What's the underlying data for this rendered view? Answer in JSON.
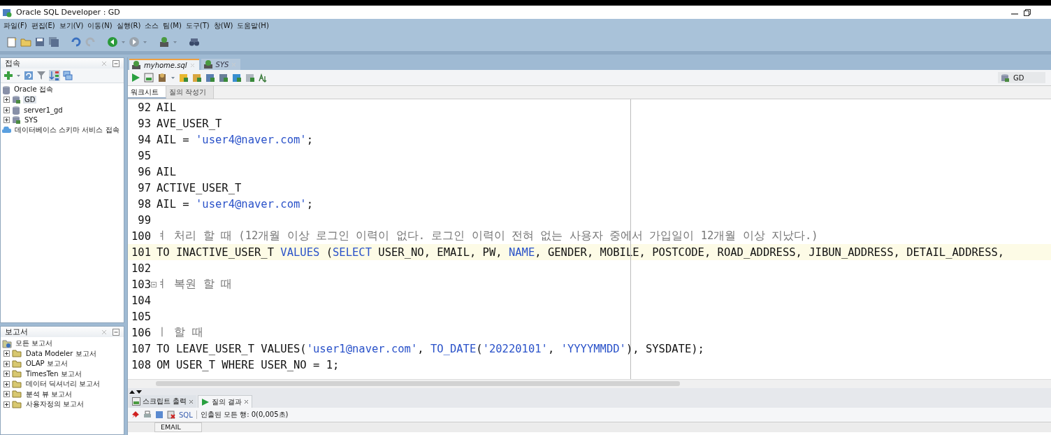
{
  "window": {
    "title": "Oracle SQL Developer : GD"
  },
  "menu": [
    "파일(F)",
    "편집(E)",
    "보기(V)",
    "이동(N)",
    "실행(R)",
    "소스",
    "팀(M)",
    "도구(T)",
    "창(W)",
    "도움말(H)"
  ],
  "connections": {
    "title": "접속",
    "items": [
      {
        "label": "Oracle 접속",
        "kind": "root",
        "selected": false
      },
      {
        "label": "GD",
        "kind": "conn",
        "selected": true
      },
      {
        "label": "server1_gd",
        "kind": "db",
        "selected": false
      },
      {
        "label": "SYS",
        "kind": "conn",
        "selected": false
      },
      {
        "label": "데이터베이스 스키마 서비스 접속",
        "kind": "cloud",
        "selected": false
      }
    ]
  },
  "reports": {
    "title": "보고서",
    "root": "모든 보고서",
    "items": [
      "Data Modeler 보고서",
      "OLAP 보고서",
      "TimesTen 보고서",
      "데이터 딕셔너리 보고서",
      "분석 뷰 보고서",
      "사용자정의 보고서"
    ]
  },
  "editor_tabs": [
    {
      "label": "myhome.sql",
      "selected": true
    },
    {
      "label": "SYS",
      "selected": false
    }
  ],
  "connection_selector": "GD",
  "sub_tabs": [
    {
      "label": "워크시트",
      "selected": true
    },
    {
      "label": "질의 작성기",
      "selected": false
    }
  ],
  "lines": [
    {
      "n": "92",
      "fold": false,
      "current": false,
      "parts": [
        {
          "kind": "plain",
          "text": "AIL"
        }
      ]
    },
    {
      "n": "93",
      "fold": false,
      "current": false,
      "parts": [
        {
          "kind": "plain",
          "text": "AVE_USER_T"
        }
      ]
    },
    {
      "n": "94",
      "fold": false,
      "current": false,
      "parts": [
        {
          "kind": "plain",
          "text": "AIL = "
        },
        {
          "kind": "string",
          "text": "'user4@naver.com'"
        },
        {
          "kind": "plain",
          "text": ";"
        }
      ]
    },
    {
      "n": "95",
      "fold": false,
      "current": false
    },
    {
      "n": "96",
      "fold": false,
      "current": false,
      "parts": [
        {
          "kind": "plain",
          "text": "AIL"
        }
      ]
    },
    {
      "n": "97",
      "fold": false,
      "current": false,
      "parts": [
        {
          "kind": "plain",
          "text": "ACTIVE_USER_T"
        }
      ]
    },
    {
      "n": "98",
      "fold": false,
      "current": false,
      "parts": [
        {
          "kind": "plain",
          "text": "AIL = "
        },
        {
          "kind": "string",
          "text": "'user4@naver.com'"
        },
        {
          "kind": "plain",
          "text": ";"
        }
      ]
    },
    {
      "n": "99",
      "fold": false,
      "current": false
    },
    {
      "n": "100",
      "fold": false,
      "current": false,
      "parts": [
        {
          "kind": "comment",
          "text": "ㅕ 처리 할 때 (12개월 이상 로그인 이력이 없다. 로그인 이력이 전혀 없는 사용자 중에서 가입일이 12개월 이상 지났다.)"
        }
      ]
    },
    {
      "n": "101",
      "fold": false,
      "current": true,
      "parts": [
        {
          "kind": "plain",
          "text": "TO INACTIVE_USER_T "
        },
        {
          "kind": "keyword",
          "text": "VALUES"
        },
        {
          "kind": "plain",
          "text": " ("
        },
        {
          "kind": "keyword",
          "text": "SELECT"
        },
        {
          "kind": "plain",
          "text": " USER_NO, EMAIL, PW, "
        },
        {
          "kind": "keyword",
          "text": "NAME"
        },
        {
          "kind": "plain",
          "text": ", GENDER, MOBILE, POSTCODE, ROAD_ADDRESS, JIBUN_ADDRESS, DETAIL_ADDRESS,"
        }
      ]
    },
    {
      "n": "102",
      "fold": false,
      "current": false
    },
    {
      "n": "103",
      "fold": true,
      "current": false,
      "parts": [
        {
          "kind": "comment",
          "text": "ㅕ 복원 할 때"
        }
      ]
    },
    {
      "n": "104",
      "fold": false,
      "current": false
    },
    {
      "n": "105",
      "fold": false,
      "current": false
    },
    {
      "n": "106",
      "fold": false,
      "current": false,
      "parts": [
        {
          "kind": "comment",
          "text": "ㅣ 할 때"
        }
      ]
    },
    {
      "n": "107",
      "fold": false,
      "current": false,
      "parts": [
        {
          "kind": "plain",
          "text": "TO LEAVE_USER_T VALUES("
        },
        {
          "kind": "string",
          "text": "'user1@naver.com'"
        },
        {
          "kind": "plain",
          "text": ", "
        },
        {
          "kind": "keyword",
          "text": "TO_DATE"
        },
        {
          "kind": "plain",
          "text": "("
        },
        {
          "kind": "string",
          "text": "'20220101'"
        },
        {
          "kind": "plain",
          "text": ", "
        },
        {
          "kind": "string",
          "text": "'YYYYMMDD'"
        },
        {
          "kind": "plain",
          "text": "), SYSDATE);"
        }
      ]
    },
    {
      "n": "108",
      "fold": false,
      "current": false,
      "parts": [
        {
          "kind": "plain",
          "text": "OM USER_T WHERE USER_NO = 1;"
        }
      ]
    }
  ],
  "output_tabs": [
    {
      "label": "스크립트 출력",
      "selected": false
    },
    {
      "label": "질의 결과",
      "selected": true
    }
  ],
  "output_sql": "SQL",
  "output_status": "인출된 모든 행: 0(0,005초)",
  "result_columns": [
    "EMAIL"
  ]
}
